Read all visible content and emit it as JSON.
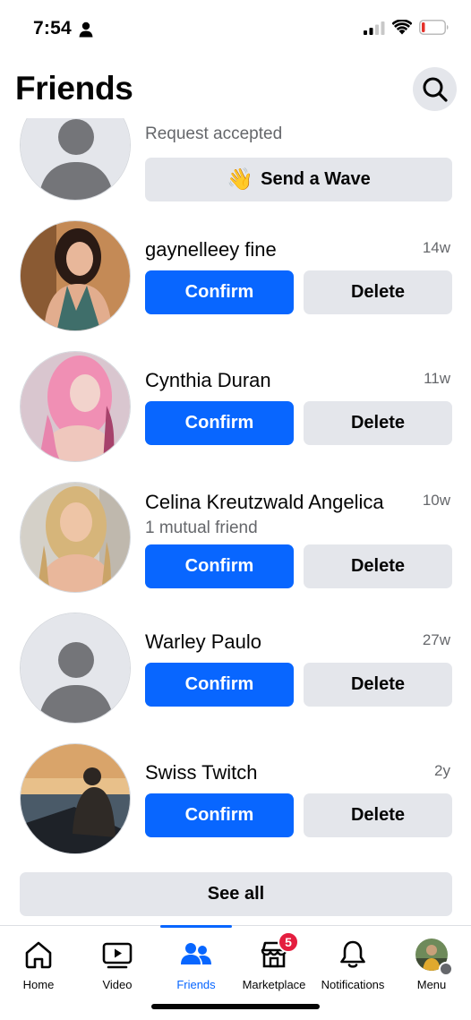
{
  "status_bar": {
    "time": "7:54"
  },
  "header": {
    "title": "Friends"
  },
  "accepted_request": {
    "status_text": "Request accepted",
    "wave_button_label": "Send a Wave",
    "wave_emoji": "👋"
  },
  "requests": [
    {
      "name": "gaynelleey fine",
      "time": "14w",
      "mutual": "",
      "confirm_label": "Confirm",
      "delete_label": "Delete"
    },
    {
      "name": "Cynthia Duran",
      "time": "11w",
      "mutual": "",
      "confirm_label": "Confirm",
      "delete_label": "Delete"
    },
    {
      "name": "Celina Kreutzwald Angelica",
      "time": "10w",
      "mutual": "1 mutual friend",
      "confirm_label": "Confirm",
      "delete_label": "Delete"
    },
    {
      "name": "Warley Paulo",
      "time": "27w",
      "mutual": "",
      "confirm_label": "Confirm",
      "delete_label": "Delete"
    },
    {
      "name": "Swiss Twitch",
      "time": "2y",
      "mutual": "",
      "confirm_label": "Confirm",
      "delete_label": "Delete"
    }
  ],
  "see_all_label": "See all",
  "tab_bar": {
    "tabs": [
      {
        "label": "Home",
        "icon": "home-icon"
      },
      {
        "label": "Video",
        "icon": "video-icon"
      },
      {
        "label": "Friends",
        "icon": "friends-icon",
        "active": true
      },
      {
        "label": "Marketplace",
        "icon": "marketplace-icon",
        "badge": "5"
      },
      {
        "label": "Notifications",
        "icon": "bell-icon"
      },
      {
        "label": "Menu",
        "icon": "profile-avatar"
      }
    ]
  },
  "colors": {
    "accent": "#0866ff",
    "button_gray": "#e4e6eb",
    "badge_red": "#e41e3f",
    "secondary_text": "#65676b"
  }
}
